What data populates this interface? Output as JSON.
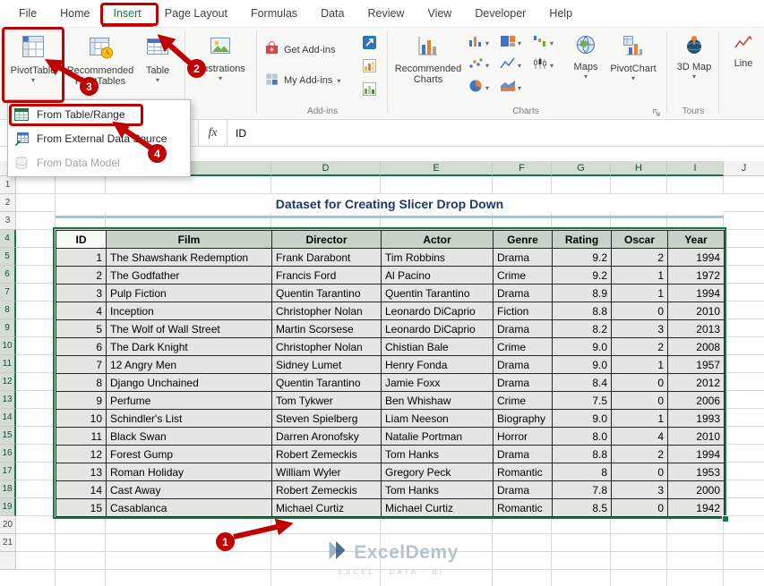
{
  "colors": {
    "excel_green": "#217346",
    "selection_green": "#107C41",
    "annotation_red": "#C00000",
    "title_navy": "#1F3864",
    "title_underline_blue": "#9DC3E6"
  },
  "ribbon": {
    "tabs": [
      "File",
      "Home",
      "Insert",
      "Page Layout",
      "Formulas",
      "Data",
      "Review",
      "View",
      "Developer",
      "Help"
    ],
    "active_tab": "Insert",
    "buttons": {
      "pivottable": "PivotTable",
      "recommended_pivottables": "Recommended PivotTables",
      "table": "Table",
      "illustrations": "Illustrations",
      "get_addins": "Get Add-ins",
      "my_addins": "My Add-ins",
      "recommended_charts": "Recommended Charts",
      "maps": "Maps",
      "pivotchart": "PivotChart",
      "map_3d": "3D Map",
      "line": "Line"
    },
    "group_labels": {
      "addins": "Add-ins",
      "charts": "Charts",
      "tours": "Tours"
    }
  },
  "pivot_menu": {
    "items": [
      {
        "label": "From Table/Range",
        "icon": "table-range-icon",
        "enabled": true
      },
      {
        "label": "From External Data Source",
        "icon": "external-source-icon",
        "enabled": true
      },
      {
        "label": "From Data Model",
        "icon": "data-model-icon",
        "enabled": false
      }
    ]
  },
  "formula_bar": {
    "fx_label": "fx",
    "value": "ID"
  },
  "sheet": {
    "visible_columns": [
      "D",
      "E",
      "F",
      "G",
      "H",
      "I",
      "J"
    ],
    "first_row": 1,
    "last_row": 21,
    "selection": {
      "first_col": "B",
      "last_col": "I",
      "first_row": 4,
      "last_row": 19
    }
  },
  "worksheet": {
    "title": "Dataset for Creating Slicer Drop Down",
    "table": {
      "headers": [
        "ID",
        "Film",
        "Director",
        "Actor",
        "Genre",
        "Rating",
        "Oscar",
        "Year"
      ],
      "rows": [
        [
          "1",
          "The Shawshank Redemption",
          "Frank Darabont",
          "Tim Robbins",
          "Drama",
          "9.2",
          "2",
          "1994"
        ],
        [
          "2",
          "The Godfather",
          "Francis Ford",
          "Al Pacino",
          "Crime",
          "9.2",
          "1",
          "1972"
        ],
        [
          "3",
          "Pulp Fiction",
          "Quentin Tarantino",
          "Quentin Tarantino",
          "Drama",
          "8.9",
          "1",
          "1994"
        ],
        [
          "4",
          "Inception",
          "Christopher Nolan",
          "Leonardo DiCaprio",
          "Fiction",
          "8.8",
          "0",
          "2010"
        ],
        [
          "5",
          "The Wolf of Wall Street",
          "Martin Scorsese",
          "Leonardo DiCaprio",
          "Drama",
          "8.2",
          "3",
          "2013"
        ],
        [
          "6",
          "The Dark Knight",
          "Christopher Nolan",
          "Chistian Bale",
          "Crime",
          "9.0",
          "2",
          "2008"
        ],
        [
          "7",
          "12 Angry Men",
          "Sidney Lumet",
          "Henry Fonda",
          "Drama",
          "9.0",
          "1",
          "1957"
        ],
        [
          "8",
          "Django Unchained",
          "Quentin Tarantino",
          "Jamie Foxx",
          "Drama",
          "8.4",
          "0",
          "2012"
        ],
        [
          "9",
          "Perfume",
          "Tom Tykwer",
          "Ben Whishaw",
          "Crime",
          "7.5",
          "0",
          "2006"
        ],
        [
          "10",
          "Schindler's List",
          "Steven Spielberg",
          "Liam Neeson",
          "Biography",
          "9.0",
          "1",
          "1993"
        ],
        [
          "11",
          "Black Swan",
          "Darren Aronofsky",
          "Natalie Portman",
          "Horror",
          "8.0",
          "4",
          "2010"
        ],
        [
          "12",
          "Forest Gump",
          "Robert Zemeckis",
          "Tom Hanks",
          "Drama",
          "8.8",
          "2",
          "1994"
        ],
        [
          "13",
          "Roman Holiday",
          "William Wyler",
          "Gregory Peck",
          "Romantic",
          "8",
          "0",
          "1953"
        ],
        [
          "14",
          "Cast Away",
          "Robert Zemeckis",
          "Tom Hanks",
          "Drama",
          "7.8",
          "3",
          "2000"
        ],
        [
          "15",
          "Casablanca",
          "Michael Curtiz",
          "Michael Curtiz",
          "Romantic",
          "8.5",
          "0",
          "1942"
        ]
      ]
    }
  },
  "annotations": {
    "step1": "1",
    "step2": "2",
    "step3": "3",
    "step4": "4"
  },
  "watermark": {
    "brand": "ExcelDemy",
    "tagline": "EXCEL · DATA · BI"
  }
}
